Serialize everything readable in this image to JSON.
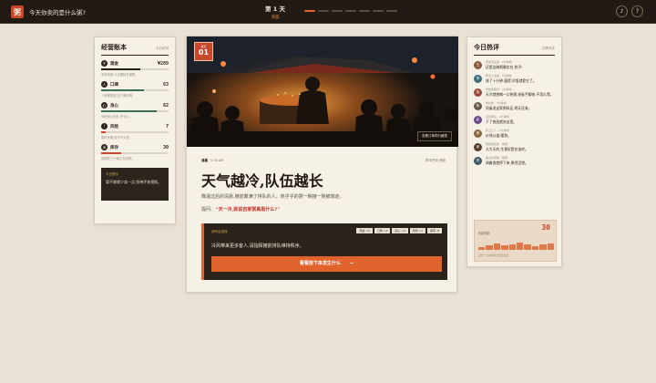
{
  "header": {
    "brand_glyph": "粥",
    "title": "今天你卖的是什么粥?",
    "day_title": "第 1 天",
    "day_sub": "清晨",
    "progress_total": 7,
    "progress_current": 1,
    "btn_sound": "♪",
    "btn_help": "?"
  },
  "ledger": {
    "title": "经营账本",
    "tag": "今日状况",
    "stats": [
      {
        "icon": "¥",
        "label": "现金",
        "value": "¥289",
        "fill": 0.58,
        "color": "#2a211b",
        "desc": "本钱有限,今日要精打细算。"
      },
      {
        "icon": "人",
        "label": "口碑",
        "value": "63",
        "fill": 0.63,
        "color": "#3c6e5a",
        "desc": "人家都知道,这个粥好喝。"
      },
      {
        "icon": "心",
        "label": "良心",
        "value": "82",
        "fill": 0.82,
        "color": "#3c6e5a",
        "desc": "你的良心还在,不亏心。"
      },
      {
        "icon": "!",
        "label": "风险",
        "value": "7",
        "fill": 0.07,
        "color": "#c8472c",
        "desc": "暂时安稳,但不可大意。"
      },
      {
        "icon": "米",
        "label": "库存",
        "value": "30",
        "fill": 0.3,
        "color": "#c8472c",
        "desc": "还能煮三十碗左右的粥。"
      }
    ],
    "tip_label": "今日提示",
    "tip_text": "冒不够就少卖一点,别带坏老规矩。"
  },
  "event": {
    "badge_label": "第天",
    "badge_num": "01",
    "photo_button": "查看订单同行藏表",
    "meta_tag": "清晨",
    "meta_time": "5:30 AM",
    "meta_right": "早市开张·西街",
    "headline": "天气越冷,队伍越长",
    "summary": "降温过后的清晨,摊前聚满了排队的人。热乎乎的粥一碗接一碗被端走。",
    "question_label": "提问:",
    "question_text": "“天一冷,就说自家粥真是什么?”",
    "decide_label": "请作出选择",
    "chips": [
      "现金 +0",
      "口碑 +2",
      "良心 +0",
      "风险 +1",
      "库存 -8"
    ],
    "decide_text": "冷风带来更多客人,请指挥摊前排队维持秩序。",
    "cta_label": "看看接下来发生什么",
    "cta_arrow": "→"
  },
  "hot_comments": {
    "title": "今日热评",
    "tag": "共享评论",
    "items": [
      {
        "initial": "王",
        "color": "#8a5a3c",
        "meta": "西街老主顾 · 6分钟前",
        "text": "还是这碗粥最实在,热乎!"
      },
      {
        "initial": "李",
        "color": "#3c6e7a",
        "meta": "附近上班族 · 5分钟前",
        "text": "排了十分钟,值得,早饭就靠它了。"
      },
      {
        "initial": "张",
        "color": "#9a4a3c",
        "meta": "早起晨跑者 · 4分钟前",
        "text": "天冷就想喝一口热粥,老板手脚快,不用久等。"
      },
      {
        "initial": "陈",
        "color": "#6a5a48",
        "meta": "学生党 · 3分钟前",
        "text": "同桌说这家粥料足,明天还来。"
      },
      {
        "initial": "赵",
        "color": "#6a4a8a",
        "meta": "夜班司机 · 2分钟前",
        "text": "下了夜班就奔这里。"
      },
      {
        "initial": "周",
        "color": "#8a6a3c",
        "meta": "环卫工人 · 1分钟前",
        "text": "价钱公道,暖和。"
      },
      {
        "initial": "吴",
        "color": "#5a3c2c",
        "meta": "隔壁卖菜的 · 刚刚",
        "text": "大冷天的,生意好是应该的。"
      },
      {
        "initial": "郑",
        "color": "#3c5a6a",
        "meta": "路过的游客 · 刚刚",
        "text": "闻着香就停下来,果然没错。"
      }
    ],
    "heat_label": "热度指数",
    "heat_value": "30",
    "heat_bars": [
      0.35,
      0.55,
      0.7,
      0.5,
      0.6,
      0.8,
      0.65,
      0.45,
      0.6,
      0.7
    ],
    "heat_foot": "过去一小时的评论热度变化"
  }
}
